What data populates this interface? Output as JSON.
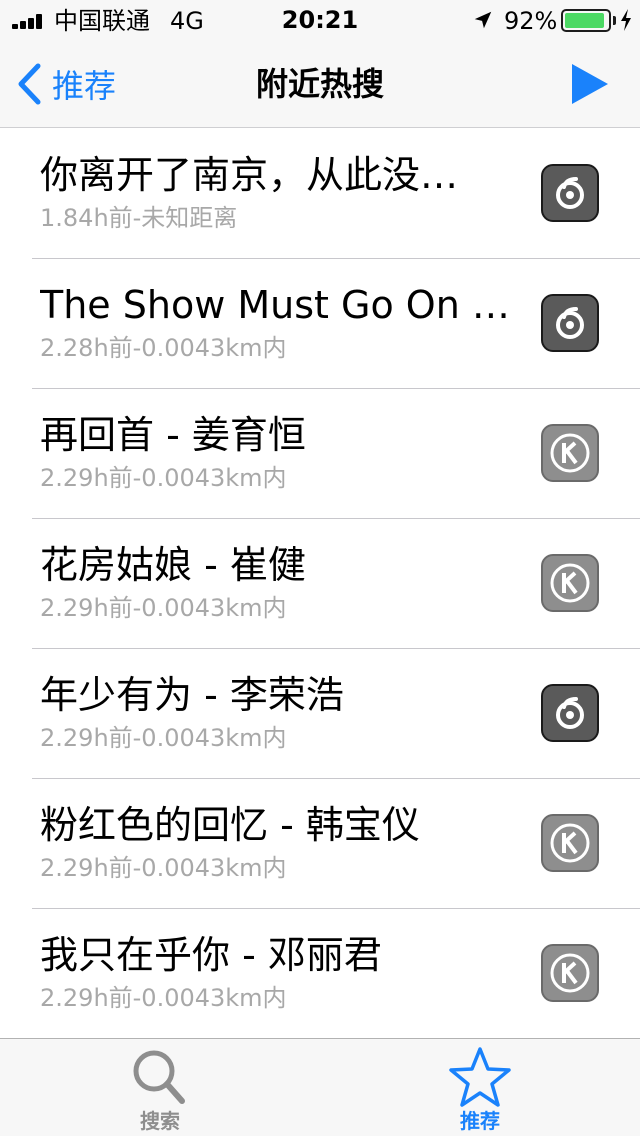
{
  "status_bar": {
    "carrier": "中国联通",
    "network": "4G",
    "time": "20:21",
    "battery_percent": "92%",
    "battery_level": 0.92,
    "battery_color": "#4cd964"
  },
  "nav": {
    "back_label": "推荐",
    "title": "附近热搜",
    "accent_color": "#1a82fb"
  },
  "songs": [
    {
      "title": "你离开了南京，从此没…",
      "subtitle": "1.84h前-未知距离",
      "source_icon": "netease-music-icon"
    },
    {
      "title": "The Show Must Go On - P…",
      "subtitle": "2.28h前-0.0043km内",
      "source_icon": "netease-music-icon"
    },
    {
      "title": "再回首 - 姜育恒",
      "subtitle": "2.29h前-0.0043km内",
      "source_icon": "kugou-icon"
    },
    {
      "title": "花房姑娘 - 崔健",
      "subtitle": "2.29h前-0.0043km内",
      "source_icon": "kugou-icon"
    },
    {
      "title": "年少有为 - 李荣浩",
      "subtitle": "2.29h前-0.0043km内",
      "source_icon": "netease-music-icon"
    },
    {
      "title": "粉红色的回忆 - 韩宝仪",
      "subtitle": "2.29h前-0.0043km内",
      "source_icon": "kugou-icon"
    },
    {
      "title": "我只在乎你 - 邓丽君",
      "subtitle": "2.29h前-0.0043km内",
      "source_icon": "kugou-icon"
    }
  ],
  "tabs": [
    {
      "label": "搜索",
      "icon": "search-icon",
      "active": false
    },
    {
      "label": "推荐",
      "icon": "star-icon",
      "active": true
    }
  ]
}
